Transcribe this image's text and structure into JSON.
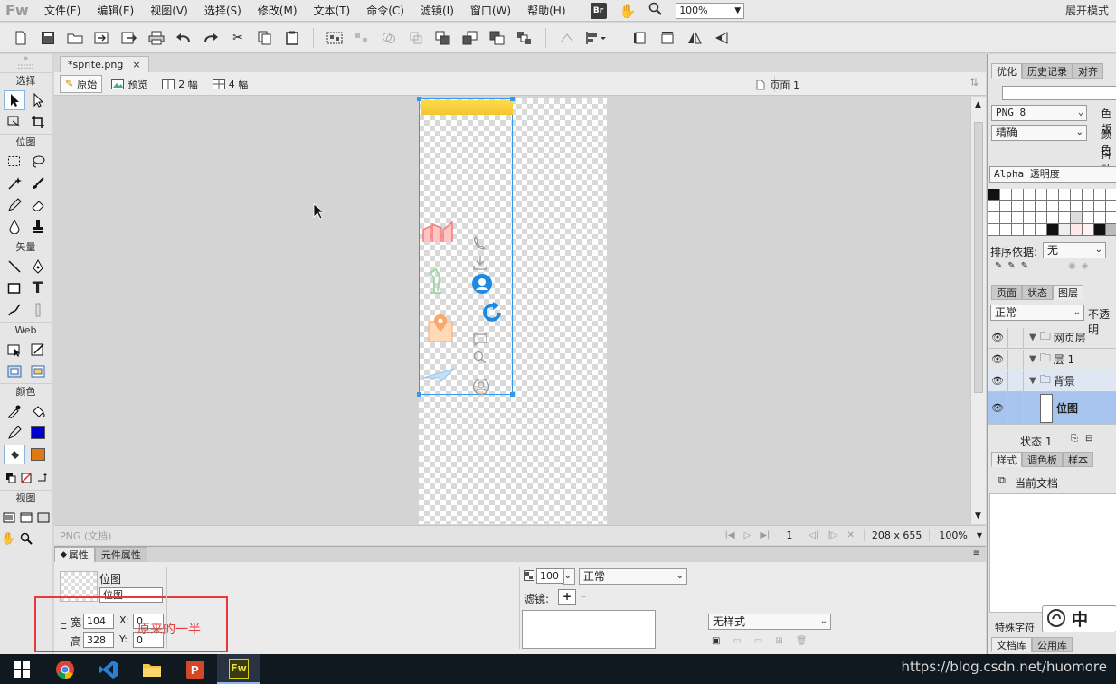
{
  "menubar": {
    "logo": "Fw",
    "items": [
      "文件(F)",
      "编辑(E)",
      "视图(V)",
      "选择(S)",
      "修改(M)",
      "文本(T)",
      "命令(C)",
      "滤镜(I)",
      "窗口(W)",
      "帮助(H)"
    ],
    "br_badge": "Br",
    "zoom": "100%",
    "expand_mode": "展开模式"
  },
  "tools": {
    "sections": [
      "选择",
      "位图",
      "矢量",
      "Web",
      "颜色",
      "视图"
    ],
    "stroke_color": "#0000cc",
    "fill_color": "#e07a10"
  },
  "document": {
    "tab_name": "*sprite.png",
    "tab_close": "×",
    "views": [
      "原始",
      "预览",
      "2 幅",
      "4 幅"
    ],
    "page": "页面 1",
    "status_left": "PNG (文档)",
    "frame": "1",
    "dimensions": "208 x 655",
    "zoom": "100%"
  },
  "properties": {
    "tabs": [
      "属性",
      "元件属性"
    ],
    "object_type": "位图",
    "object_name": "位图",
    "width_label": "宽",
    "width": "104",
    "height_label": "高",
    "height": "328",
    "x_label": "X:",
    "x": "0",
    "y_label": "Y:",
    "y": "0",
    "annotation": "原来的一半",
    "opacity": "100",
    "blend_mode": "正常",
    "filters_label": "滤镜:",
    "style": "无样式"
  },
  "right_panel": {
    "optimize_tabs": [
      "优化",
      "历史记录",
      "对齐"
    ],
    "format": "PNG 8",
    "palette_mode": "精确",
    "side_labels": [
      "色版",
      "颜色",
      "抖动"
    ],
    "alpha": "Alpha 透明度",
    "sort_label": "排序依据:",
    "sort_value": "无",
    "layer_tabs": [
      "页面",
      "状态",
      "图层"
    ],
    "blend": "正常",
    "opacity_label": "不透明",
    "layers": [
      "网页层",
      "层 1",
      "背景",
      "位图"
    ],
    "state": "状态 1",
    "style_tabs": [
      "样式",
      "调色板",
      "样本"
    ],
    "current_doc": "当前文档",
    "special_chars": "特殊字符",
    "lib_tabs": [
      "文档库",
      "公用库"
    ],
    "ime_char": "中"
  },
  "taskbar": {
    "watermark": "https://blog.csdn.net/huomore",
    "apps": [
      "windows-start",
      "chrome",
      "vscode",
      "file-explorer",
      "powerpoint",
      "fireworks"
    ],
    "fw_label": "Fw"
  }
}
